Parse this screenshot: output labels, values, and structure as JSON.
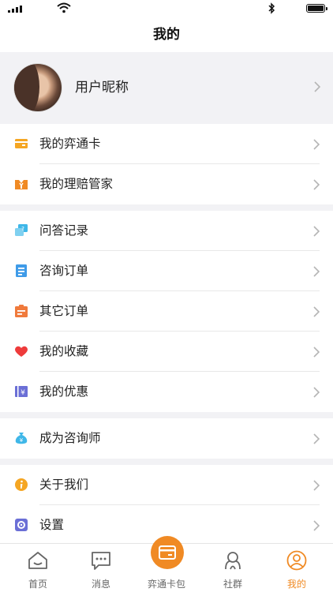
{
  "nav": {
    "title": "我的"
  },
  "profile": {
    "nickname": "用户昵称"
  },
  "groups": [
    {
      "items": [
        {
          "label": "我的弈通卡",
          "icon": "card-icon",
          "color": "#f5a623"
        },
        {
          "label": "我的理赔管家",
          "icon": "butler-icon",
          "color": "#f08a24"
        }
      ]
    },
    {
      "items": [
        {
          "label": "问答记录",
          "icon": "qa-icon",
          "color": "#3fb7e8"
        },
        {
          "label": "咨询订单",
          "icon": "consult-order-icon",
          "color": "#3f9be8"
        },
        {
          "label": "其它订单",
          "icon": "other-order-icon",
          "color": "#f07a3c"
        },
        {
          "label": "我的收藏",
          "icon": "heart-icon",
          "color": "#ee3b3b"
        },
        {
          "label": "我的优惠",
          "icon": "coupon-icon",
          "color": "#6b6fd6"
        }
      ]
    },
    {
      "items": [
        {
          "label": "成为咨询师",
          "icon": "moneybag-icon",
          "color": "#3fb7e8"
        }
      ]
    },
    {
      "items": [
        {
          "label": "关于我们",
          "icon": "info-icon",
          "color": "#f5a623"
        },
        {
          "label": "设置",
          "icon": "settings-icon",
          "color": "#6b6fd6"
        }
      ]
    }
  ],
  "tabbar": {
    "tabs": [
      {
        "label": "首页",
        "icon": "home-icon"
      },
      {
        "label": "消息",
        "icon": "message-icon"
      },
      {
        "label": "弈通卡包",
        "icon": "card-wallet-icon"
      },
      {
        "label": "社群",
        "icon": "community-icon"
      },
      {
        "label": "我的",
        "icon": "profile-icon"
      }
    ],
    "active_color": "#f08a24"
  }
}
